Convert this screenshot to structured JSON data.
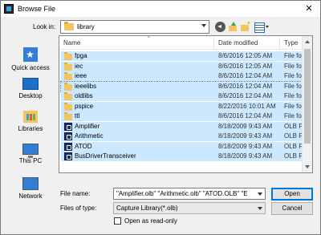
{
  "window": {
    "title": "Browse File",
    "close_glyph": "✕"
  },
  "toolbar": {
    "lookin_label": "Look in:",
    "lookin_value": "library",
    "icons": [
      "back-icon",
      "up-folder-icon",
      "new-folder-icon",
      "view-menu-icon"
    ]
  },
  "places": [
    {
      "label": "Quick access",
      "icon": "quick-access-icon"
    },
    {
      "label": "Desktop",
      "icon": "desktop-icon"
    },
    {
      "label": "Libraries",
      "icon": "libraries-icon"
    },
    {
      "label": "This PC",
      "icon": "this-pc-icon"
    },
    {
      "label": "Network",
      "icon": "network-icon"
    }
  ],
  "columns": {
    "name": "Name",
    "date": "Date modified",
    "type": "Type"
  },
  "files": [
    {
      "name": "fpga",
      "date": "8/6/2016 12:05 AM",
      "type": "File fol",
      "kind": "folder",
      "state": "selected"
    },
    {
      "name": "iec",
      "date": "8/6/2016 12:05 AM",
      "type": "File fol",
      "kind": "folder",
      "state": "selected"
    },
    {
      "name": "ieee",
      "date": "8/6/2016 12:04 AM",
      "type": "File fol",
      "kind": "folder",
      "state": "selected"
    },
    {
      "name": "ieeelibs",
      "date": "8/6/2016 12:04 AM",
      "type": "File fol",
      "kind": "folder",
      "state": "focused"
    },
    {
      "name": "oldlibs",
      "date": "8/6/2016 12:04 AM",
      "type": "File fol",
      "kind": "folder",
      "state": "selected"
    },
    {
      "name": "pspice",
      "date": "8/22/2016 10:01 AM",
      "type": "File fol",
      "kind": "folder",
      "state": "selected"
    },
    {
      "name": "ttl",
      "date": "8/6/2016 12:04 AM",
      "type": "File fol",
      "kind": "folder",
      "state": "selected"
    },
    {
      "name": "Amplifier",
      "date": "8/18/2009 9:43 AM",
      "type": "OLB Fi",
      "kind": "olb",
      "state": "selected"
    },
    {
      "name": "Arithmetic",
      "date": "8/18/2009 9:43 AM",
      "type": "OLB Fi",
      "kind": "olb",
      "state": "selected"
    },
    {
      "name": "ATOD",
      "date": "8/18/2009 9:43 AM",
      "type": "OLB Fi",
      "kind": "olb",
      "state": "selected"
    },
    {
      "name": "BusDriverTransceiver",
      "date": "8/18/2009 9:43 AM",
      "type": "OLB Fi",
      "kind": "olb",
      "state": "selected"
    }
  ],
  "form": {
    "filename_label": "File name:",
    "filename_value": "\"Amplifier.olb\" \"Arithmetic.olb\" \"ATOD.OLB\" \"E",
    "filetype_label": "Files of type:",
    "filetype_value": "Capture Library(*.olb)",
    "readonly_label": "Open as read-only",
    "readonly_checked": false,
    "open_label": "Open",
    "cancel_label": "Cancel"
  },
  "colors": {
    "selection": "#cce8ff",
    "accent": "#0078d7",
    "folder": "#f3c560"
  }
}
